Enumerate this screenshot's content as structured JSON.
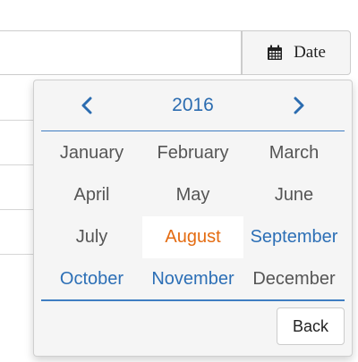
{
  "input": {
    "value": ""
  },
  "date_button": {
    "label": "Date",
    "icon": "calendar-icon"
  },
  "picker": {
    "prev_icon": "<",
    "next_icon": ">",
    "year": "2016",
    "months": [
      "January",
      "February",
      "March",
      "April",
      "May",
      "June",
      "July",
      "August",
      "September",
      "October",
      "November",
      "December"
    ],
    "selected_month": "August",
    "back_label": "Back"
  },
  "colors": {
    "accent": "#2c6fb6",
    "selected": "#e46c12",
    "muted_text": "#555555",
    "panel_bg": "#f5f5f5"
  }
}
